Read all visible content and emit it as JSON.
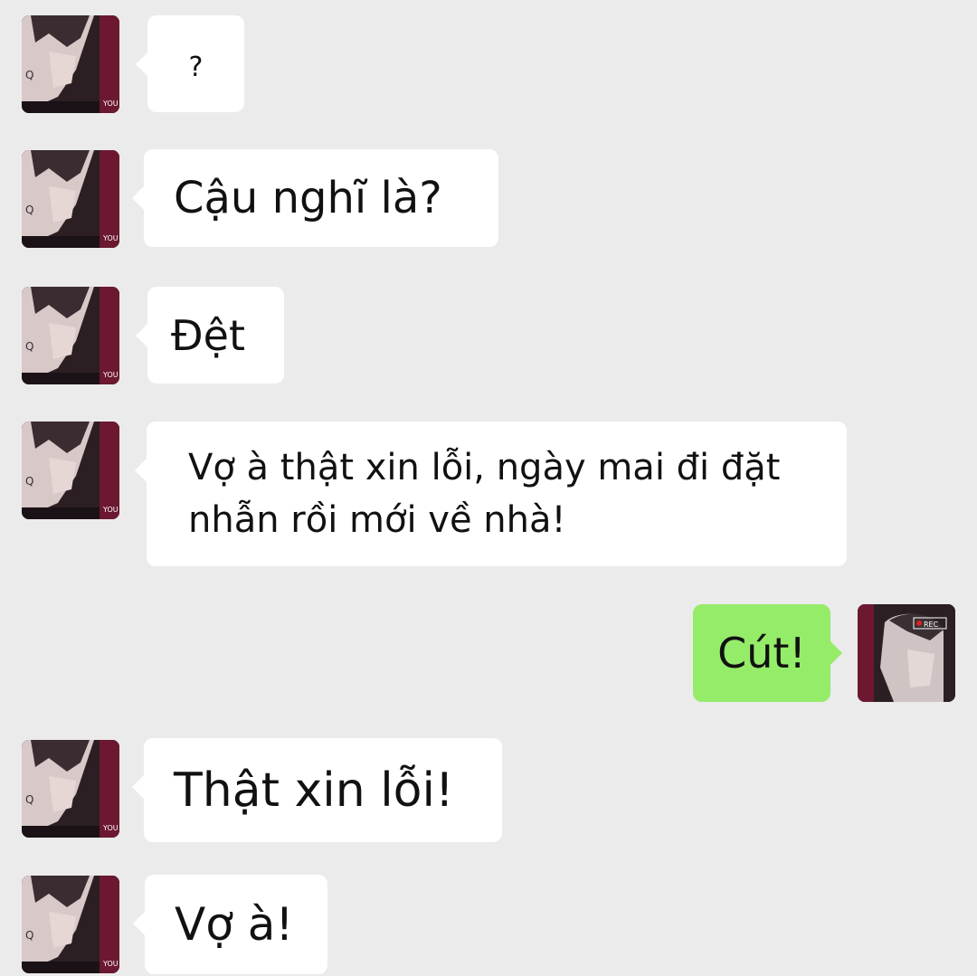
{
  "conversation": {
    "messages": [
      {
        "sender": "contact",
        "text": "?"
      },
      {
        "sender": "contact",
        "text": "Cậu nghĩ là?"
      },
      {
        "sender": "contact",
        "text": "Đệt"
      },
      {
        "sender": "contact",
        "text": "Vợ à thật xin lỗi, ngày mai đi đặt nhẫn rồi mới về nhà!"
      },
      {
        "sender": "me",
        "text": "Cút!"
      },
      {
        "sender": "contact",
        "text": "Thật xin lỗi!"
      },
      {
        "sender": "contact",
        "text": "Vợ à!"
      }
    ]
  },
  "avatars": {
    "contact": {
      "icon": "anime-man-avatar",
      "overlay_text": "YOU"
    },
    "me": {
      "icon": "anime-man-rec-avatar",
      "overlay_text": "REC"
    }
  },
  "colors": {
    "background": "#ebebeb",
    "incoming_bubble": "#ffffff",
    "outgoing_bubble": "#95ec69"
  }
}
